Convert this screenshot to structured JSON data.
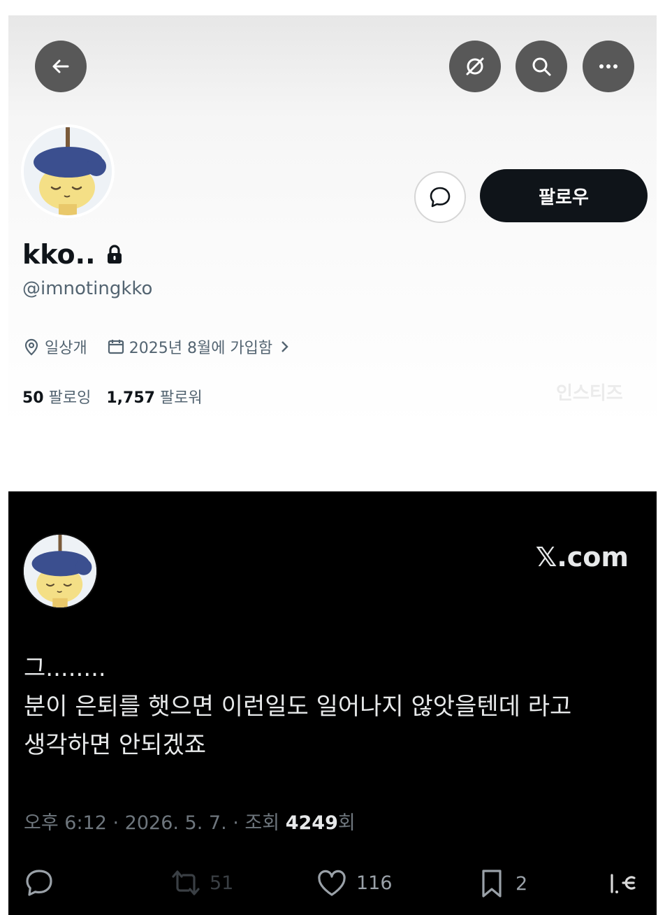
{
  "profile": {
    "display_name": "kko..",
    "handle": "@imnotingkko",
    "location": "일상개",
    "joined": "2025년 8월에 가입함",
    "following_count": "50",
    "following_label": "팔로잉",
    "followers_count": "1,757",
    "followers_label": "팔로워",
    "follow_button": "팔로우",
    "watermark": "인스티즈",
    "icons": [
      "back-arrow-icon",
      "translate-icon",
      "search-icon",
      "more-icon",
      "message-icon",
      "lock-icon",
      "location-pin-icon",
      "calendar-icon",
      "chevron-right-icon"
    ],
    "colors": {
      "button_dark": "#0f1419",
      "round_button": "#585858",
      "text_secondary": "#536471"
    }
  },
  "tweet": {
    "brand": "𝕏.com",
    "line1": "그........",
    "line2": "분이 은퇴를 햇으면 이런일도 일어나지 않앗을텐데 라고",
    "line3": "생각하면 안되겠죠",
    "time": "오후 6:12",
    "date": "2026. 5. 7.",
    "views_label": "조회",
    "views_count": "4249",
    "views_suffix": "회",
    "retweets": "51",
    "likes": "116",
    "bookmarks": "2",
    "icons": [
      "reply-icon",
      "retweet-icon",
      "heart-icon",
      "bookmark-icon",
      "share-icon"
    ],
    "colors": {
      "background": "#000000",
      "text": "#e7e9ea",
      "muted": "#6e767d"
    }
  }
}
